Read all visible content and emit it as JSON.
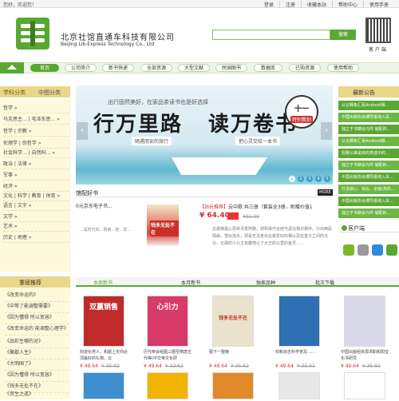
{
  "topbar": {
    "welcome": "您好，欢迎您！",
    "links": [
      "登录",
      "注册",
      "收藏本站",
      "帮助中心",
      "使用手册"
    ]
  },
  "header": {
    "company_cn": "北京社馆直通车科技有限公司",
    "company_en": "Beijing Lib-Express Technology Co., Ltd",
    "search_placeholder": "",
    "search_button": "搜索",
    "qr_label": "客 户 端"
  },
  "nav": {
    "items": [
      "首页",
      "公司简介",
      "新书快递",
      "全部资源",
      "大型文献",
      "民国图书",
      "数据库",
      "已购资源",
      "使用帮助"
    ],
    "active": 0
  },
  "sidebar": {
    "tab1": "学科分类",
    "tab2": "中图分类",
    "categories": [
      "哲学 »",
      "马克思主... | 毛泽东思... »",
      "哲学 | 宗教 »",
      "伦理学 | 伪哲学 »",
      "社会科学... | 自然科... »",
      "政治 | 法律 »",
      "军事 »",
      "经济 »",
      "文化 | 科学 | 教育 | 体育 »",
      "语言 | 文字 »",
      "文学 »",
      "艺术 »",
      "历史 | 地理 »"
    ]
  },
  "banner": {
    "slogan": "出行固然美好，在家品茶读书也是好选择",
    "big1": "行万里路",
    "big2": "读万卷书",
    "sub1": "随遇而安的旅行",
    "sub2": "把心灵交给一本书",
    "badge_top": "十一",
    "badge_bottom": "特别策划",
    "pages": [
      "1",
      "2",
      "3",
      "4",
      "5"
    ],
    "active_page": 0
  },
  "good_books": {
    "title": "馆配好书",
    "more": "MORE",
    "left_item": "0元京东电子书...",
    "left_desc": "...是时代的...则被...他...安...",
    "featured_cover_title": "钱多无处不在",
    "featured_title_prefix": "【站长推荐】",
    "featured_title": "云中歌 共三册（套装全3册，附赠价值1",
    "price": "¥ 64.40",
    "old_price": "¥92.00",
    "desc": "云歌嫁是心思转寻觅阿陵，却机缘巧合结与孟珏相识相伴。引出两段情缘，雪似流水，却是无法走出云歌爱好的相以及在皇子之间的沉沦，云歌的小公主有趣地让了大王的公里的金灵……"
  },
  "right_panel": {
    "news_title": "最新公告",
    "news": [
      "从云狮象汇看Android相...",
      "中国出版协会博导报询入关...",
      "独立于书籍会元件 储配的...",
      "从云狮象汇看Android相...",
      "彪雅公来是体的类选中的...",
      "独立于书籍会元件 储配的...",
      "中国出版协会博导报询入关...",
      "打造核心、综合、全面(高的...",
      "中国出版协会博导报询入关...",
      "独立于书籍会元件 储配的..."
    ],
    "client_title": "客户端"
  },
  "recommend": {
    "title": "重磅推荐",
    "items": [
      "《改变命运的》",
      "《中等了能调整需要》",
      "《因为懂得 所以宽容》",
      "《改变命运的 能调整心理学》",
      "《品彩生哪的对》",
      "《聚歇人生》",
      "《大明国了》",
      "《因为懂得 所以宽容》",
      "《钱多无处不在》",
      "《资生之道》"
    ]
  },
  "book_tabs": {
    "tabs": [
      "本周新书",
      "本月新书",
      "独家品种",
      "批次下载"
    ],
    "active": 0
  },
  "books": [
    {
      "title": "钧道化男人，和超上天你必须最好的礼物。云",
      "price": "¥ 49.64",
      "old": "¥ 35.92",
      "cover_color": "#c12a2a",
      "cover_text": "双赢销售"
    },
    {
      "title": "历代帝会组图三圈至隋唐五代等(中华帝文化研",
      "price": "¥ 49.64",
      "old": "¥ 32.62",
      "cover_color": "#d83a6a",
      "cover_text": "心引力"
    },
    {
      "title": "图下一整晚",
      "price": "¥ 49.64",
      "old": "¥ 35.62",
      "cover_color": "#e9e2cc",
      "cover_text": "钱多无处不在"
    },
    {
      "title": "钧和杂志科学普及……",
      "price": "¥ 49.64",
      "old": "¥ 35.92",
      "cover_color": "#2f6fb3",
      "cover_text": ""
    },
    {
      "title": "中国出版组资源求职和阳宝化书研究",
      "price": "¥ 49.64",
      "old": "¥ 35.92",
      "cover_color": "#d8d8e8",
      "cover_text": ""
    }
  ],
  "books_row2": [
    "#3d8fd0",
    "#f1b400",
    "#e08a2a",
    "#e8e8e8",
    "#ffffff"
  ]
}
